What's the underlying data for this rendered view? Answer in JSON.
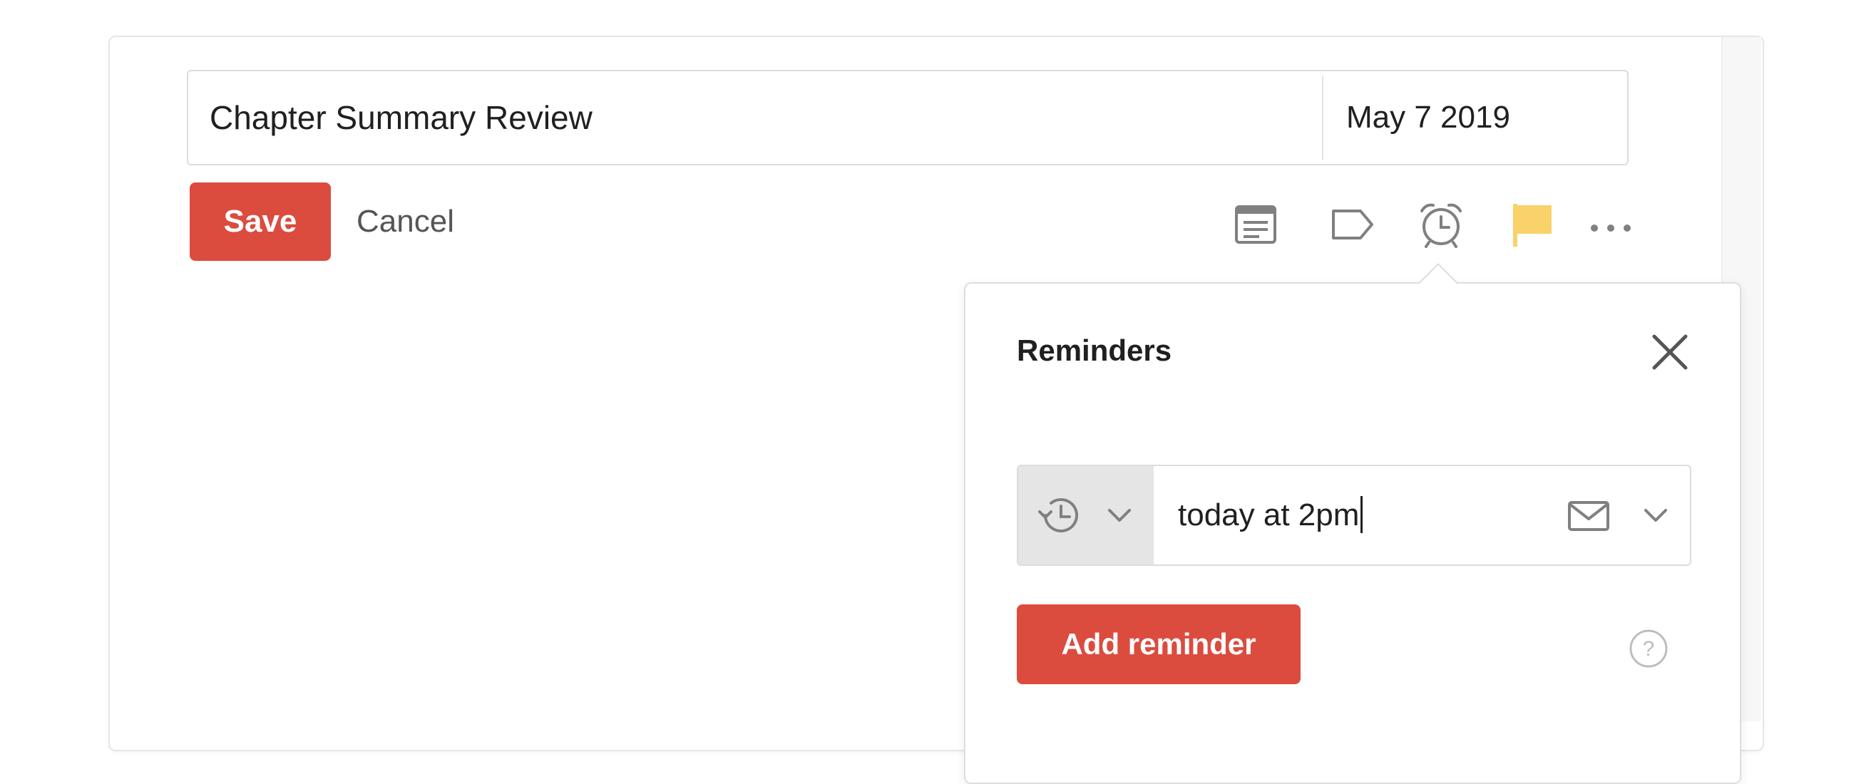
{
  "task": {
    "name": "Chapter Summary Review",
    "due_date": "May 7 2019"
  },
  "actions": {
    "save_label": "Save",
    "cancel_label": "Cancel"
  },
  "toolbar": {
    "icons": [
      "comments-icon",
      "label-icon",
      "alarm-clock-icon",
      "flag-icon",
      "more-icon"
    ],
    "flag_color": "#f9d26a"
  },
  "reminders": {
    "title": "Reminders",
    "input_value": "today at 2pm",
    "type_icon": "relative-time-icon",
    "notify_icon": "email-icon",
    "add_label": "Add reminder"
  },
  "colors": {
    "accent": "#db4c3f",
    "icon_gray": "#808080"
  }
}
